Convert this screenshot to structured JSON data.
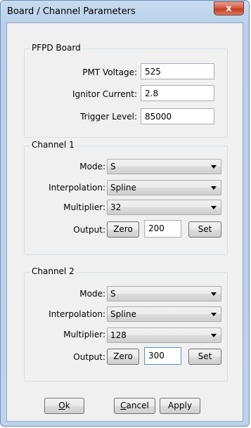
{
  "window": {
    "title": "Board / Channel Parameters",
    "close_glyph": "x"
  },
  "pfpd": {
    "group_label": "PFPD Board",
    "pmt_voltage_label": "PMT Voltage:",
    "pmt_voltage_value": "525",
    "ignitor_current_label": "Ignitor Current:",
    "ignitor_current_value": "2.8",
    "trigger_level_label": "Trigger Level:",
    "trigger_level_value": "85000"
  },
  "channel1": {
    "group_label": "Channel 1",
    "mode_label": "Mode:",
    "mode_value": "S",
    "interpolation_label": "Interpolation:",
    "interpolation_value": "Spline",
    "multiplier_label": "Multiplier:",
    "multiplier_value": "32",
    "output_label": "Output:",
    "zero_label": "Zero",
    "output_value": "200",
    "set_label": "Set"
  },
  "channel2": {
    "group_label": "Channel 2",
    "mode_label": "Mode:",
    "mode_value": "S",
    "interpolation_label": "Interpolation:",
    "interpolation_value": "Spline",
    "multiplier_label": "Multiplier:",
    "multiplier_value": "128",
    "output_label": "Output:",
    "zero_label": "Zero",
    "output_value": "300",
    "set_label": "Set"
  },
  "footer": {
    "ok_mnemonic": "O",
    "ok_rest": "k",
    "cancel_mnemonic": "C",
    "cancel_rest": "ancel",
    "apply_label": "Apply"
  }
}
